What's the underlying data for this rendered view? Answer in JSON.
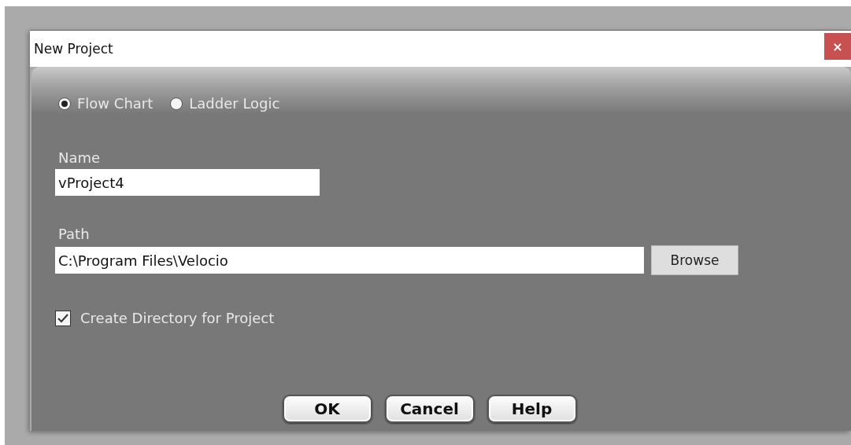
{
  "window": {
    "title": "New Project",
    "close": "×"
  },
  "project_type": [
    {
      "label": "Flow Chart",
      "selected": true
    },
    {
      "label": "Ladder Logic",
      "selected": false
    }
  ],
  "name": {
    "label": "Name",
    "value": "vProject4"
  },
  "path": {
    "label": "Path",
    "value": "C:\\Program Files\\Velocio",
    "browse": "Browse"
  },
  "create_directory": {
    "label": "Create Directory for Project",
    "checked": true
  },
  "buttons": [
    "OK",
    "Cancel",
    "Help"
  ]
}
